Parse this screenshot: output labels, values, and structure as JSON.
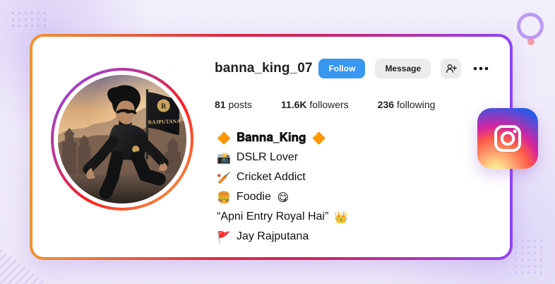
{
  "profile": {
    "username": "banna_king_07",
    "buttons": {
      "follow": "Follow",
      "message": "Message"
    },
    "icons": {
      "add_user": "add-user-icon",
      "more": "more-options-icon",
      "instagram": "instagram-logo"
    },
    "stats": {
      "posts_value": "81",
      "posts_label": "posts",
      "followers_value": "11.6K",
      "followers_label": "followers",
      "following_value": "236",
      "following_label": "following"
    },
    "bio": {
      "display_name": "𝐁𝐚𝐧𝐧𝐚_𝐊𝐢𝐧𝐠",
      "line1": "DSLR Lover",
      "line2": "Cricket Addict",
      "line3": "Foodie",
      "line4": "“Apni Entry Royal Hai”",
      "line5": "Jay Rajputana",
      "emoji": {
        "name_left": "🔶",
        "name_right": "🔶",
        "camera": "📸",
        "cricket": "🏏",
        "food": "🍔",
        "yum": "😋",
        "crown": "👑",
        "flag": "🚩"
      }
    },
    "avatar": {
      "flag_text": "RAJPUTANA",
      "crest_letter": "R"
    },
    "colors": {
      "follow_blue": "#3897f0",
      "message_gray": "#ececec",
      "card_border_start": "#f09433",
      "card_border_end": "#8e44f8",
      "instagram_pink": "#d6249f"
    }
  }
}
